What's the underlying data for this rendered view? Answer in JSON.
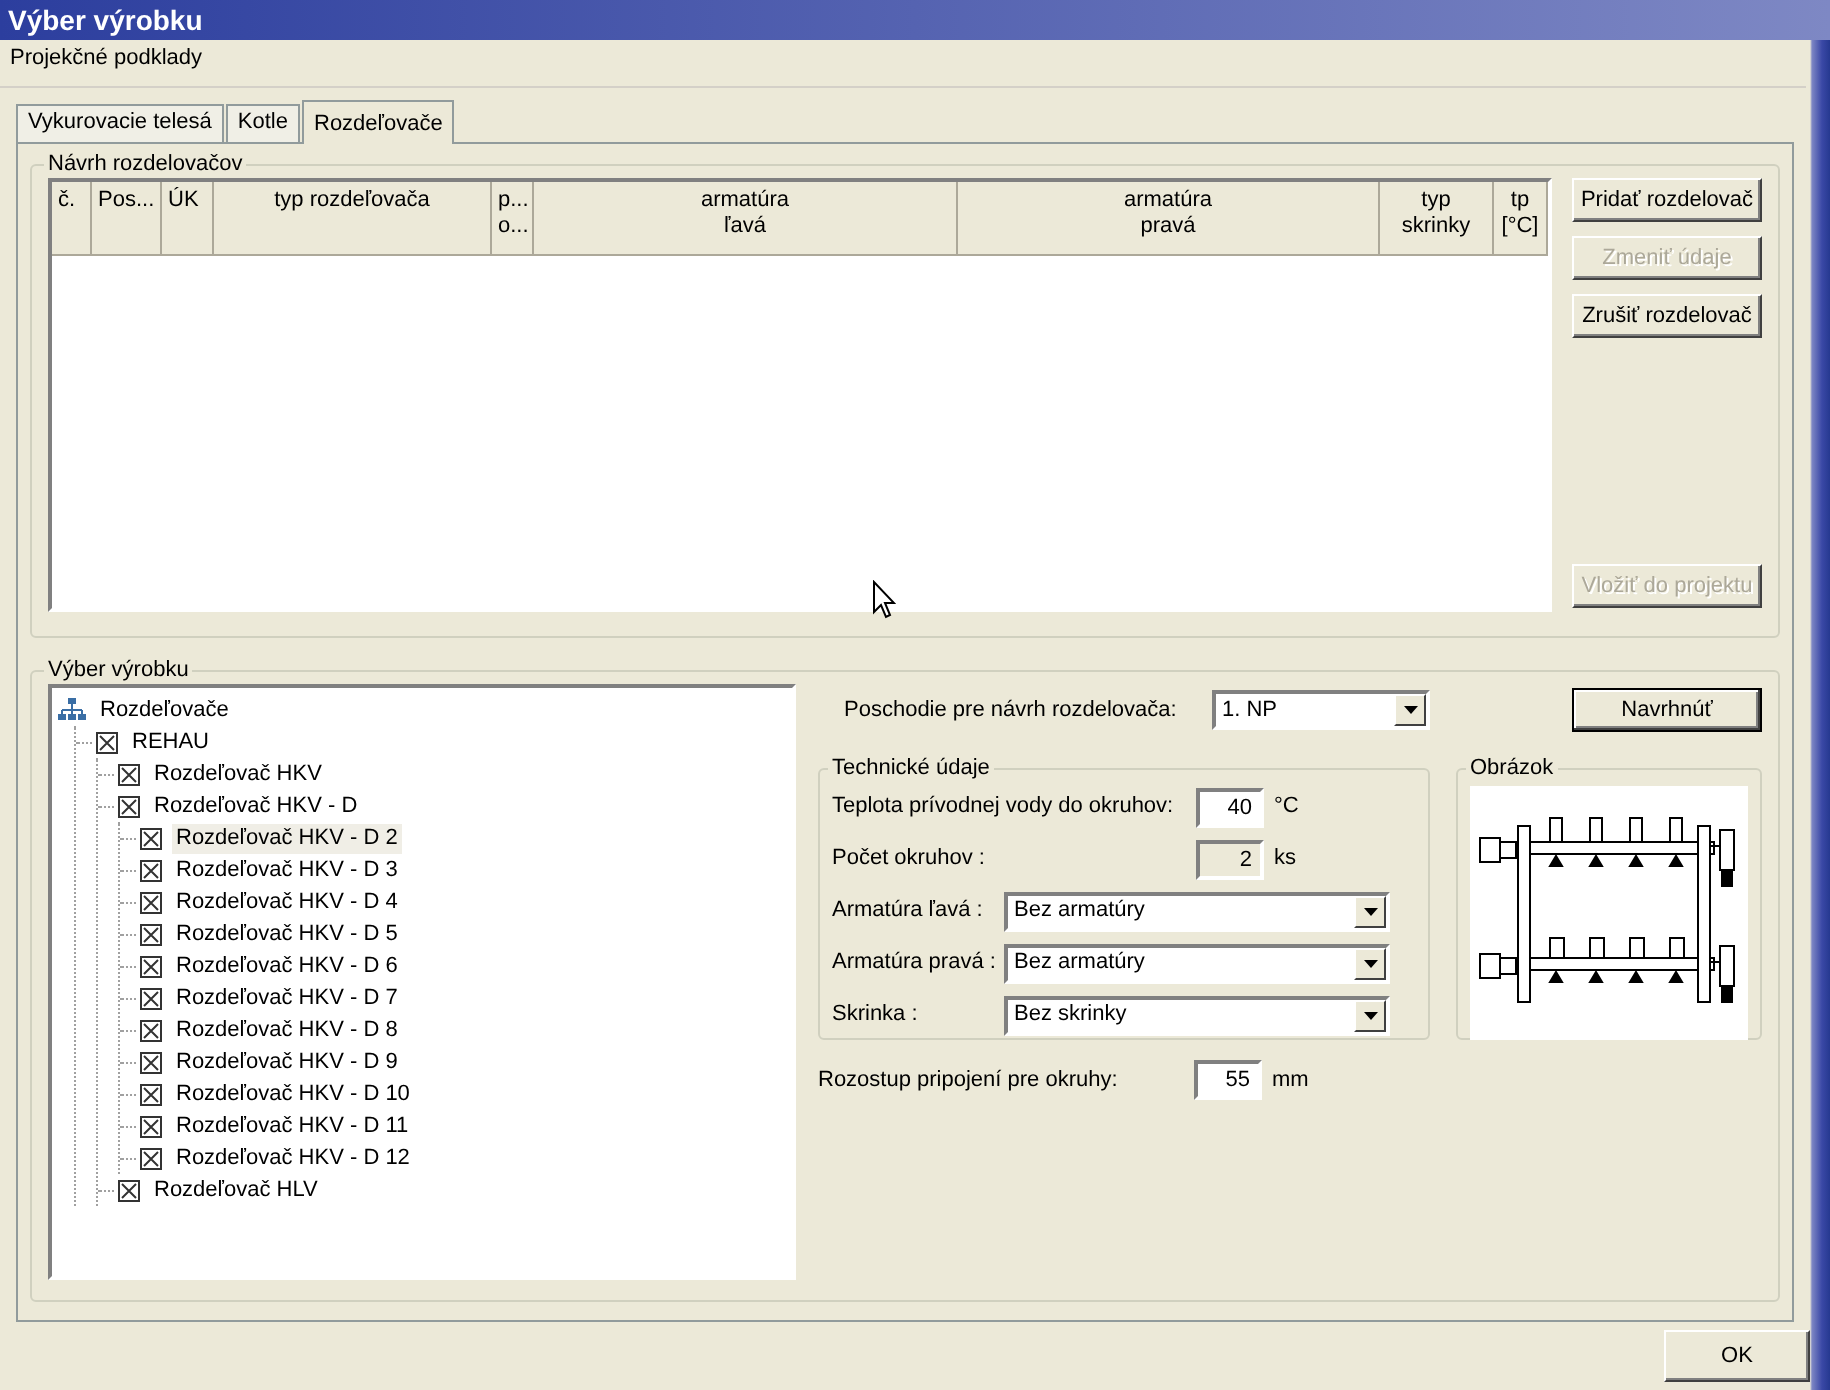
{
  "window": {
    "title": "Výber výrobku"
  },
  "menu": [
    "Projekčné podklady"
  ],
  "tabs": [
    {
      "label": "Vykurovacie telesá",
      "selected": false
    },
    {
      "label": "Kotle",
      "selected": false
    },
    {
      "label": "Rozdeľovače",
      "selected": true
    }
  ],
  "design_group": {
    "title": "Návrh rozdelovačov",
    "table": {
      "columns": [
        {
          "lines": [
            "č."
          ]
        },
        {
          "lines": [
            "Pos..."
          ]
        },
        {
          "lines": [
            "ÚK"
          ]
        },
        {
          "lines": [
            "typ rozdeľovača"
          ]
        },
        {
          "lines": [
            "p...",
            "o..."
          ]
        },
        {
          "lines": [
            "armatúra",
            "ľavá"
          ]
        },
        {
          "lines": [
            "armatúra",
            "pravá"
          ]
        },
        {
          "lines": [
            "typ",
            "skrinky"
          ]
        },
        {
          "lines": [
            "tp",
            "[°C]"
          ]
        }
      ]
    },
    "buttons": [
      {
        "label": "Pridať rozdelovač",
        "disabled": false
      },
      {
        "label": "Zmeniť údaje",
        "disabled": true
      },
      {
        "label": "Zrušiť rozdelovač",
        "disabled": false
      }
    ],
    "bottom_button": {
      "label": "Vložiť do projektu",
      "disabled": true
    }
  },
  "product_group": {
    "title": "Výber výrobku",
    "tree": [
      {
        "label": "Rozdeľovače",
        "kind": "root",
        "selected": false,
        "children": [
          {
            "label": "REHAU",
            "kind": "item",
            "selected": false,
            "children": [
              {
                "label": "Rozdeľovač HKV",
                "kind": "item",
                "selected": false
              },
              {
                "label": "Rozdeľovač HKV - D",
                "kind": "item",
                "selected": false,
                "children": [
                  {
                    "label": "Rozdeľovač HKV - D 2",
                    "kind": "item",
                    "selected": true
                  },
                  {
                    "label": "Rozdeľovač HKV - D 3",
                    "kind": "item",
                    "selected": false
                  },
                  {
                    "label": "Rozdeľovač HKV - D 4",
                    "kind": "item",
                    "selected": false
                  },
                  {
                    "label": "Rozdeľovač HKV - D 5",
                    "kind": "item",
                    "selected": false
                  },
                  {
                    "label": "Rozdeľovač HKV - D 6",
                    "kind": "item",
                    "selected": false
                  },
                  {
                    "label": "Rozdeľovač HKV - D 7",
                    "kind": "item",
                    "selected": false
                  },
                  {
                    "label": "Rozdeľovač HKV - D 8",
                    "kind": "item",
                    "selected": false
                  },
                  {
                    "label": "Rozdeľovač HKV - D 9",
                    "kind": "item",
                    "selected": false
                  },
                  {
                    "label": "Rozdeľovač HKV - D 10",
                    "kind": "item",
                    "selected": false
                  },
                  {
                    "label": "Rozdeľovač HKV - D 11",
                    "kind": "item",
                    "selected": false
                  },
                  {
                    "label": "Rozdeľovač HKV - D 12",
                    "kind": "item",
                    "selected": false
                  }
                ]
              },
              {
                "label": "Rozdeľovač HLV",
                "kind": "item",
                "selected": false
              }
            ]
          }
        ]
      }
    ],
    "floor": {
      "label": "Poschodie pre návrh rozdelovača:",
      "value": "1. NP"
    },
    "design_button": {
      "label": "Navrhnúť"
    },
    "technical": {
      "title": "Technické údaje",
      "fields": [
        {
          "kind": "number",
          "label": "Teplota prívodnej vody do okruhov:",
          "value": "40",
          "unit": "°C",
          "disabled": false
        },
        {
          "kind": "number",
          "label": "Počet okruhov :",
          "value": "2",
          "unit": "ks",
          "disabled": true
        },
        {
          "kind": "select",
          "label": "Armatúra ľavá :",
          "value": "Bez armatúry"
        },
        {
          "kind": "select",
          "label": "Armatúra pravá :",
          "value": "Bez armatúry"
        },
        {
          "kind": "select",
          "label": "Skrinka :",
          "value": "Bez skrinky"
        }
      ]
    },
    "image": {
      "title": "Obrázok"
    },
    "spacing": {
      "label": "Rozostup pripojení pre okruhy:",
      "value": "55",
      "unit": "mm"
    }
  },
  "footer_buttons": [
    "OK"
  ]
}
